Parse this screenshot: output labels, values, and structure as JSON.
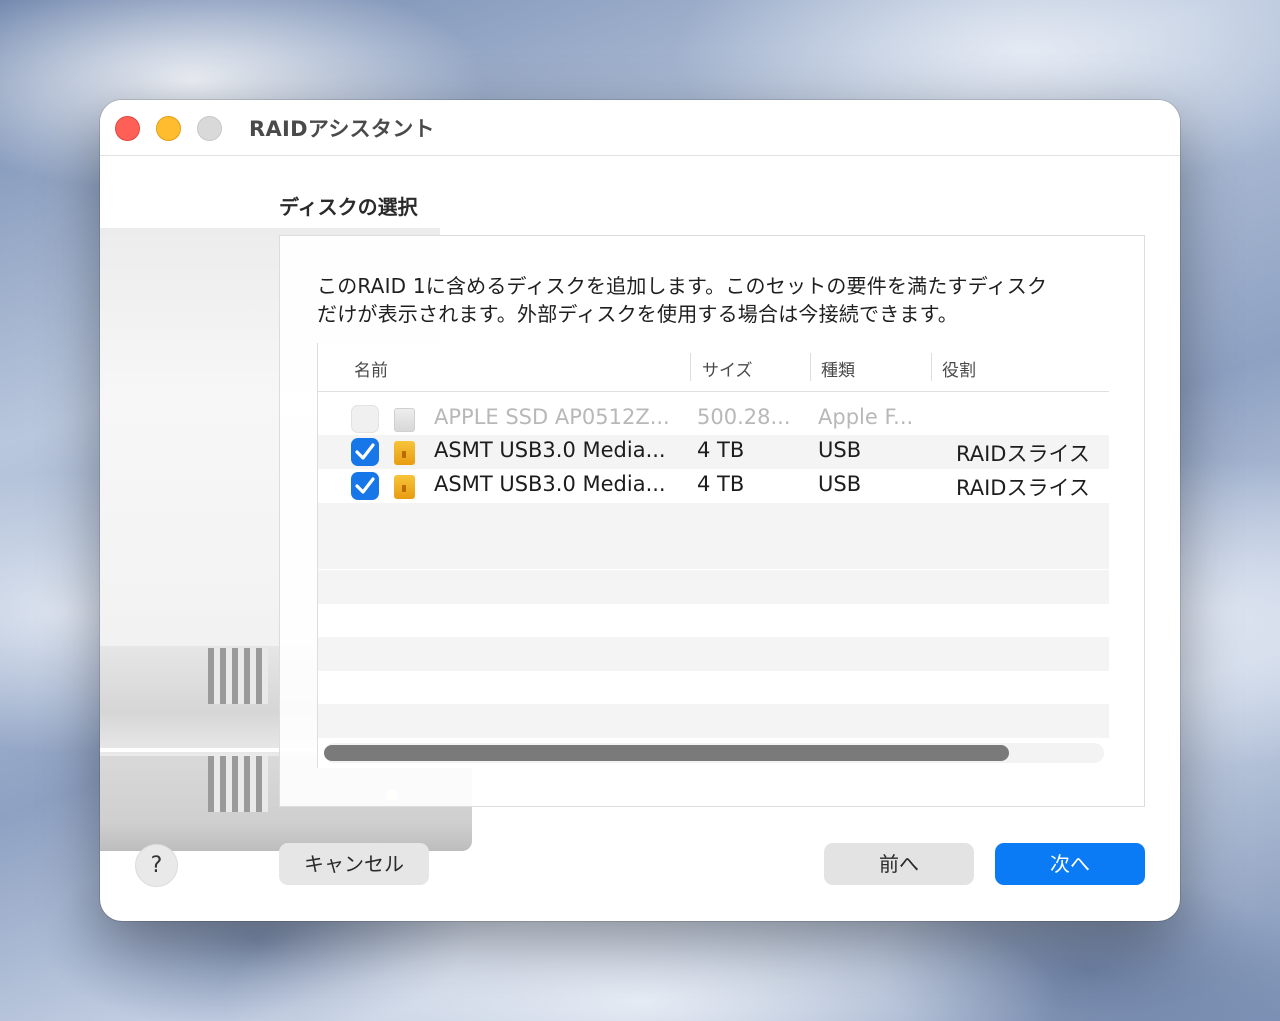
{
  "window": {
    "title": "RAIDアシスタント"
  },
  "section": {
    "title": "ディスクの選択"
  },
  "description": {
    "line1": "このRAID 1に含めるディスクを追加します。このセットの要件を満たすディスク",
    "line2": "だけが表示されます。外部ディスクを使用する場合は今接続できます。"
  },
  "table": {
    "columns": [
      "名前",
      "サイズ",
      "種類",
      "役割"
    ],
    "rows": [
      {
        "name": "APPLE SSD AP0512Z...",
        "size": "500.28...",
        "type": "Apple F...",
        "role": "",
        "checked": false,
        "disabled": true,
        "icon": "internal-disk-icon"
      },
      {
        "name": "ASMT USB3.0 Media...",
        "size": "4 TB",
        "type": "USB",
        "role": "RAIDスライス",
        "checked": true,
        "disabled": false,
        "icon": "external-disk-icon"
      },
      {
        "name": "ASMT USB3.0 Media...",
        "size": "4 TB",
        "type": "USB",
        "role": "RAIDスライス",
        "checked": true,
        "disabled": false,
        "icon": "external-disk-icon"
      }
    ]
  },
  "buttons": {
    "help": "?",
    "cancel": "キャンセル",
    "back": "前へ",
    "next": "次へ"
  },
  "colors": {
    "accent": "#0a7bf5",
    "checkbox": "#1776e8",
    "close": "#fe5f57",
    "minimize": "#febc2e",
    "zoom": "#d9d9d9"
  }
}
